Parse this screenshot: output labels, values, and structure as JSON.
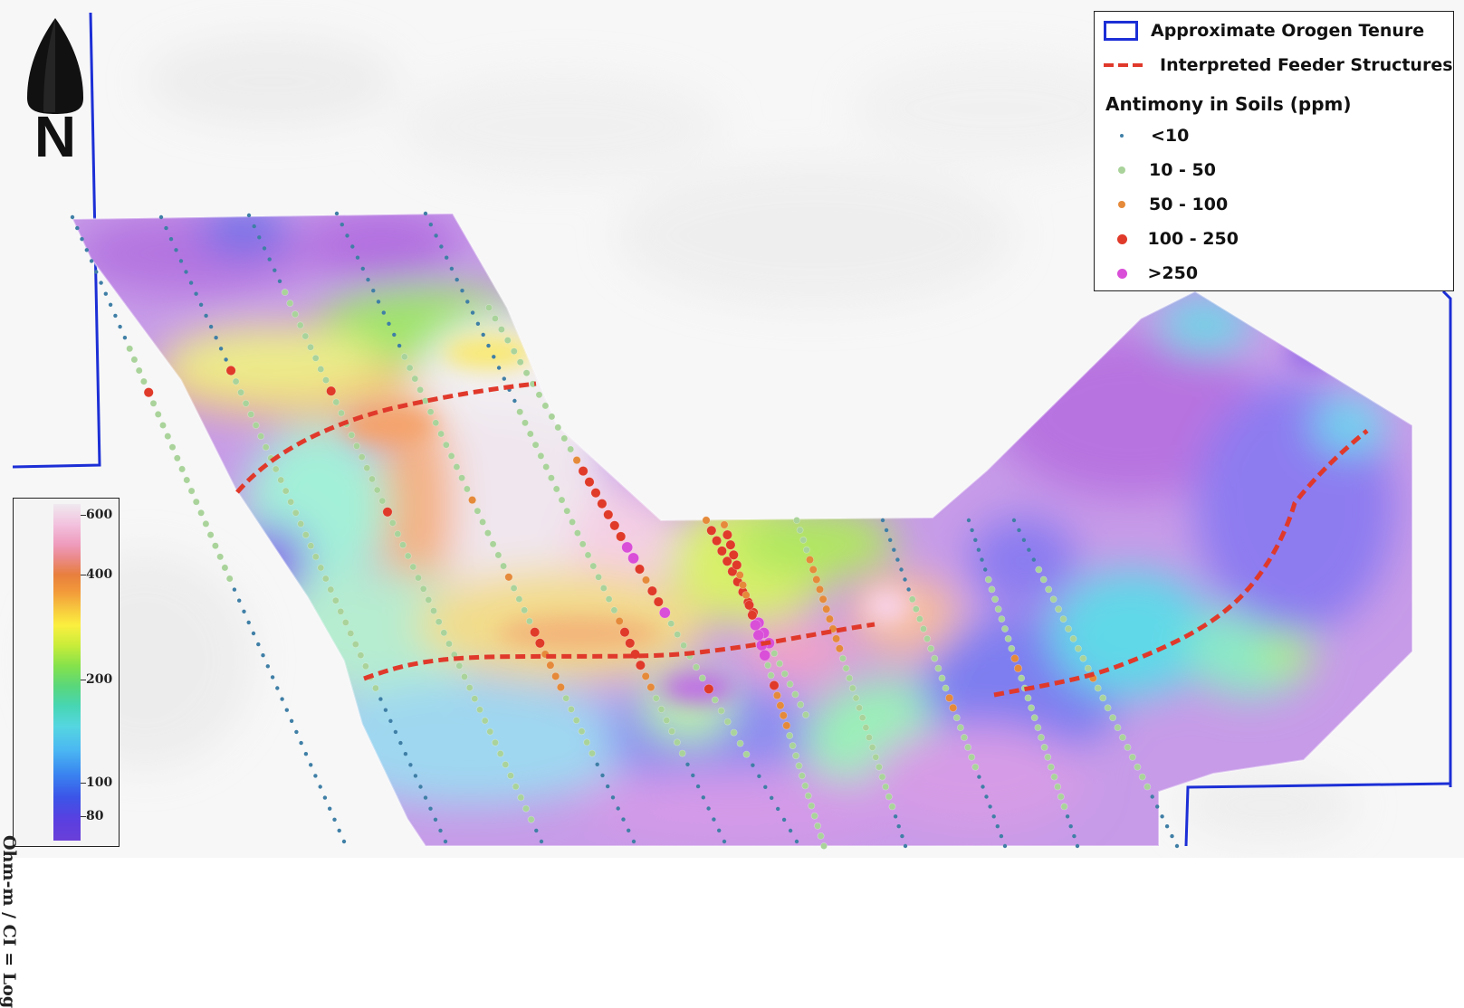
{
  "legend": {
    "tenure_label": "Approximate Orogen Tenure",
    "feeder_label": "Interpreted Feeder Structures",
    "title": "Antimony in Soils (ppm)",
    "classes": [
      {
        "label": "<10",
        "color": "#3f7fa6",
        "size": "small"
      },
      {
        "label": "10 - 50",
        "color": "#a9d39a",
        "size": "medium"
      },
      {
        "label": "50 - 100",
        "color": "#e58a3a",
        "size": "medium"
      },
      {
        "label": "100 - 250",
        "color": "#e03a2a",
        "size": "large"
      },
      {
        "label": ">250",
        "color": "#d94fd8",
        "size": "large"
      }
    ],
    "tenure_color": "#1c2fd6",
    "feeder_color": "#e0392b"
  },
  "colorbar": {
    "axis_label": "Ohm-m / CI = Log",
    "ticks": [
      "600",
      "400",
      "200",
      "100",
      "80"
    ]
  },
  "north_arrow": {
    "letter": "N"
  }
}
